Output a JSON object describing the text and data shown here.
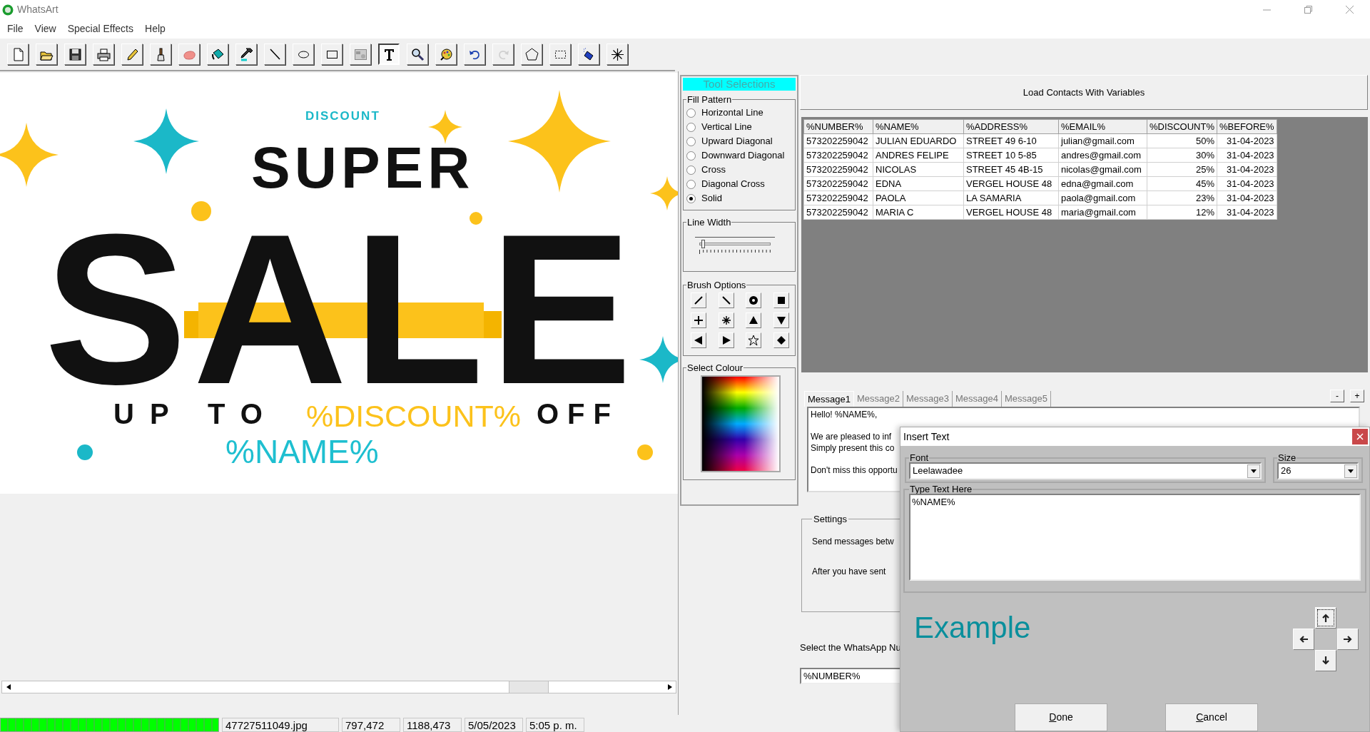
{
  "window": {
    "title": "WhatsArt"
  },
  "menu": [
    "File",
    "View",
    "Special Effects",
    "Help"
  ],
  "toolbar": [
    {
      "selected": false,
      "disabled": false
    },
    {
      "selected": false,
      "disabled": false
    },
    {
      "selected": false,
      "disabled": false
    },
    {
      "selected": false,
      "disabled": false
    },
    {
      "selected": false,
      "disabled": false
    },
    {
      "selected": false,
      "disabled": false
    },
    {
      "selected": false,
      "disabled": false
    },
    {
      "selected": false,
      "disabled": false
    },
    {
      "selected": false,
      "disabled": false
    },
    {
      "selected": false,
      "disabled": false
    },
    {
      "selected": false,
      "disabled": false
    },
    {
      "selected": false,
      "disabled": false
    },
    {
      "selected": false,
      "disabled": false
    },
    {
      "selected": true,
      "disabled": false
    },
    {
      "selected": false,
      "disabled": false
    },
    {
      "selected": false,
      "disabled": false
    },
    {
      "selected": false,
      "disabled": false
    },
    {
      "selected": false,
      "disabled": true
    },
    {
      "selected": false,
      "disabled": false
    },
    {
      "selected": false,
      "disabled": false
    },
    {
      "selected": false,
      "disabled": false
    },
    {
      "selected": false,
      "disabled": false
    }
  ],
  "canvas": {
    "texts": [
      {
        "kind": "small",
        "text": "DISCOUNT"
      },
      {
        "kind": "super",
        "text": "SUPER"
      },
      {
        "kind": "sale",
        "text": "SALE"
      },
      {
        "kind": "upto",
        "text": "UP TO"
      },
      {
        "kind": "variable-yellow",
        "text": "%DISCOUNT%"
      },
      {
        "kind": "off",
        "text": "OFF"
      },
      {
        "kind": "variable-teal",
        "text": "%NAME%"
      }
    ]
  },
  "tool_panel": {
    "title": "Tool Selections",
    "fill_pattern": {
      "label": "Fill Pattern",
      "options": [
        {
          "label": "Horizontal Line",
          "selected": false
        },
        {
          "label": "Vertical Line",
          "selected": false
        },
        {
          "label": "Upward Diagonal",
          "selected": false
        },
        {
          "label": "Downward Diagonal",
          "selected": false
        },
        {
          "label": "Cross",
          "selected": false
        },
        {
          "label": "Diagonal Cross",
          "selected": false
        },
        {
          "label": "Solid",
          "selected": true
        }
      ]
    },
    "line_width": {
      "label": "Line Width",
      "level": 0.02
    },
    "brush_options": {
      "label": "Brush Options"
    },
    "select_colour": {
      "label": "Select Colour"
    }
  },
  "contacts": {
    "button": "Load Contacts With Variables",
    "columns": [
      "%NUMBER%",
      "%NAME%",
      "%ADDRESS%",
      "%EMAIL%",
      "%DISCOUNT%",
      "%BEFORE%"
    ],
    "rows": [
      [
        "573202259042",
        "JULIAN EDUARDO",
        "STREET 49 6-10",
        "julian@gmail.com",
        "50%",
        "31-04-2023"
      ],
      [
        "573202259042",
        "ANDRES FELIPE",
        "STREET 10 5-85",
        "andres@gmail.com",
        "30%",
        "31-04-2023"
      ],
      [
        "573202259042",
        "NICOLAS",
        "STREET 45 4B-15",
        "nicolas@gmail.com",
        "25%",
        "31-04-2023"
      ],
      [
        "573202259042",
        "EDNA",
        "VERGEL HOUSE 48",
        "edna@gmail.com",
        "45%",
        "31-04-2023"
      ],
      [
        "573202259042",
        "PAOLA",
        "LA SAMARIA",
        "paola@gmail.com",
        "23%",
        "31-04-2023"
      ],
      [
        "573202259042",
        "MARIA C",
        "VERGEL HOUSE 48",
        "maria@gmail.com",
        "12%",
        "31-04-2023"
      ]
    ]
  },
  "messages": {
    "tabs": [
      {
        "label": "Message1",
        "selected": true
      },
      {
        "label": "Message2",
        "selected": false
      },
      {
        "label": "Message3",
        "selected": false
      },
      {
        "label": "Message4",
        "selected": false
      },
      {
        "label": "Message5",
        "selected": false
      }
    ],
    "buttons": [
      "-",
      "+"
    ],
    "paragraphs": [
      [
        "Hello! %NAME%,"
      ],
      [
        "We are pleased to inf",
        "Simply present this co"
      ],
      [
        "Don't miss this opportu"
      ]
    ]
  },
  "settings": {
    "label": "Settings",
    "lines": [
      "Send messages betw",
      "After you have sent"
    ]
  },
  "whatsapp": {
    "label": "Select the WhatsApp Nu",
    "value": "%NUMBER%"
  },
  "dialog": {
    "title": "Insert Text",
    "font": {
      "label": "Font",
      "value": "Leelawadee"
    },
    "size": {
      "label": "Size",
      "value": "26"
    },
    "text": {
      "label": "Type Text Here",
      "value": "%NAME%"
    },
    "preview": "Example",
    "buttons": [
      "Done",
      "Cancel"
    ]
  },
  "status_bar": {
    "progress": {
      "level": 1
    },
    "fields": [
      "47727511049.jpg",
      "797,472",
      "1188,473",
      "5/05/2023",
      "5:05 p. m."
    ]
  }
}
